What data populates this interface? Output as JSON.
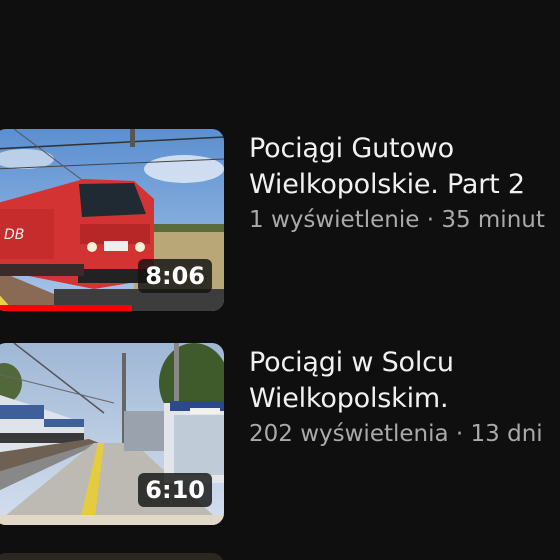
{
  "videos": [
    {
      "title_line_1": "Pociągi Gutowo",
      "title_line_2": "Wielkopolskie. Part 2",
      "views": "1 wyświetlenie",
      "separator": " · ",
      "age": "35 minut",
      "duration": "8:06",
      "watched_fraction": 0.6
    },
    {
      "title_line_1": "Pociągi w Solcu",
      "title_line_2": "Wielkopolskim.",
      "views": "202 wyświetlenia",
      "separator": " · ",
      "age": "13 dni",
      "duration": "6:10",
      "watched_fraction": 0
    }
  ]
}
